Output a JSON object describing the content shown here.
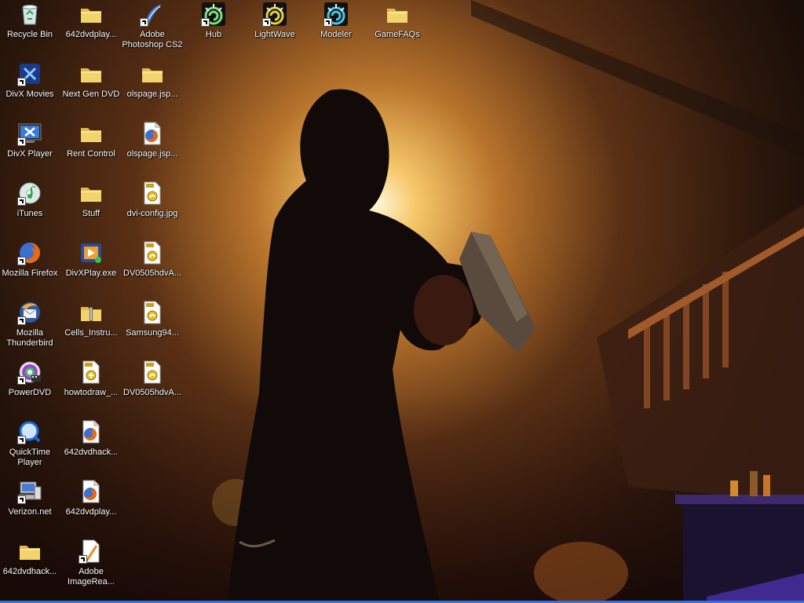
{
  "desktop": {
    "icons": [
      {
        "label": "Recycle Bin",
        "icon": "recycle-bin-icon",
        "shortcut": false
      },
      {
        "label": "DivX Movies",
        "icon": "divx-icon",
        "shortcut": true
      },
      {
        "label": "DivX Player",
        "icon": "divx-player-icon",
        "shortcut": true
      },
      {
        "label": "iTunes",
        "icon": "itunes-icon",
        "shortcut": true
      },
      {
        "label": "Mozilla Firefox",
        "icon": "firefox-icon",
        "shortcut": true
      },
      {
        "label": "Mozilla Thunderbird",
        "icon": "thunderbird-icon",
        "shortcut": true
      },
      {
        "label": "PowerDVD",
        "icon": "powerdvd-icon",
        "shortcut": true
      },
      {
        "label": "QuickTime Player",
        "icon": "quicktime-icon",
        "shortcut": true
      },
      {
        "label": "Verizon.net",
        "icon": "verizon-computer-icon",
        "shortcut": true
      },
      {
        "label": "642dvdhack...",
        "icon": "folder-icon",
        "shortcut": false
      },
      {
        "label": "642dvdplay...",
        "icon": "folder-icon",
        "shortcut": false
      },
      {
        "label": "Next Gen DVD",
        "icon": "folder-icon",
        "shortcut": false
      },
      {
        "label": "Rent Control",
        "icon": "folder-icon",
        "shortcut": false
      },
      {
        "label": "Stuff",
        "icon": "folder-icon",
        "shortcut": false
      },
      {
        "label": "DivXPlay.exe",
        "icon": "divxplay-exe-icon",
        "shortcut": false
      },
      {
        "label": "Cells_Instru...",
        "icon": "zip-folder-icon",
        "shortcut": false
      },
      {
        "label": "howtodraw_...",
        "icon": "gif-file-icon",
        "shortcut": false
      },
      {
        "label": "642dvdhack...",
        "icon": "firefox-document-icon",
        "shortcut": false
      },
      {
        "label": "642dvdplay...",
        "icon": "firefox-document-icon",
        "shortcut": false
      },
      {
        "label": "Adobe ImageRea...",
        "icon": "imageready-icon",
        "shortcut": true
      },
      {
        "label": "Adobe Photoshop CS2",
        "icon": "photoshop-icon",
        "shortcut": true
      },
      {
        "label": "olspage.jsp...",
        "icon": "folder-icon",
        "shortcut": false
      },
      {
        "label": "olspage.jsp...",
        "icon": "firefox-document-icon",
        "shortcut": false
      },
      {
        "label": "dvi-config.jpg",
        "icon": "jpg-file-icon",
        "shortcut": false
      },
      {
        "label": "DV0505hdvA...",
        "icon": "jpg-file-icon",
        "shortcut": false
      },
      {
        "label": "Samsung94...",
        "icon": "jpg-file-icon",
        "shortcut": false
      },
      {
        "label": "DV0505hdvA...",
        "icon": "jpg-file-icon",
        "shortcut": false
      },
      {
        "label": "Hub",
        "icon": "lightwave-hub-icon",
        "shortcut": true
      },
      {
        "label": "LightWave",
        "icon": "lightwave-icon",
        "shortcut": true
      },
      {
        "label": "Modeler",
        "icon": "lightwave-modeler-icon",
        "shortcut": true
      },
      {
        "label": "GameFAQs",
        "icon": "folder-icon",
        "shortcut": false
      }
    ]
  },
  "colors": {
    "folder": "#f3d36b",
    "taskbar": "#3a6fd8",
    "label_text": "#ffffff"
  }
}
